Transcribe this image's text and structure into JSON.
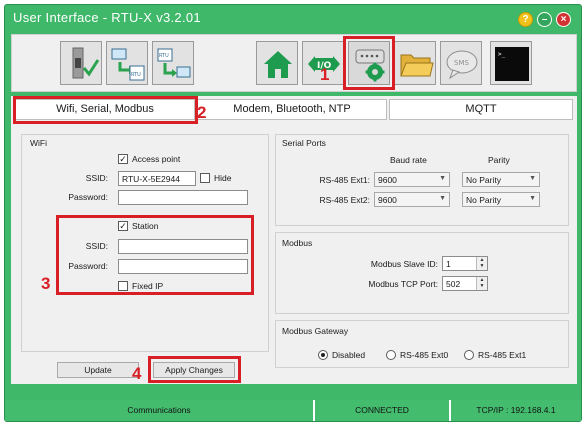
{
  "window": {
    "title": "User Interface - RTU-X v3.2.01",
    "buttons": {
      "help": "?",
      "minimize": "–",
      "close": "×"
    }
  },
  "toolbar": {
    "buttons": [
      {
        "name": "device-check",
        "icon": "usb-plug-check-icon"
      },
      {
        "name": "upload",
        "icon": "pc-to-rtu-upload-icon"
      },
      {
        "name": "download",
        "icon": "rtu-to-pc-download-icon"
      },
      {
        "name": "home",
        "icon": "home-icon"
      },
      {
        "name": "io",
        "icon": "io-arrows-icon",
        "label": "I/O"
      },
      {
        "name": "settings",
        "icon": "serial-port-gear-icon",
        "active": true
      },
      {
        "name": "open-folder",
        "icon": "folder-icon"
      },
      {
        "name": "sms",
        "icon": "sms-bubble-icon",
        "label": "SMS"
      },
      {
        "name": "terminal",
        "icon": "terminal-icon",
        "label": ">_"
      }
    ]
  },
  "annotations": [
    "1",
    "2",
    "3",
    "4"
  ],
  "tabs": [
    {
      "label": "Wifi, Serial, Modbus",
      "active": true
    },
    {
      "label": "Modem, Bluetooth, NTP",
      "active": false
    },
    {
      "label": "MQTT",
      "active": false
    }
  ],
  "wifi": {
    "group_title": "WiFi",
    "access_point": {
      "checkbox_label": "Access point",
      "checked": true,
      "ssid_label": "SSID:",
      "ssid_value": "RTU-X-5E2944",
      "hide_label": "Hide",
      "hide_checked": false,
      "password_label": "Password:",
      "password_value": ""
    },
    "station": {
      "checkbox_label": "Station",
      "checked": true,
      "ssid_label": "SSID:",
      "ssid_value": "",
      "password_label": "Password:",
      "password_value": "",
      "fixed_ip_label": "Fixed IP",
      "fixed_ip_checked": false
    }
  },
  "actions": {
    "update_label": "Update",
    "apply_label": "Apply Changes"
  },
  "serial_ports": {
    "group_title": "Serial Ports",
    "col_baud": "Baud rate",
    "col_parity": "Parity",
    "rows": [
      {
        "label": "RS-485 Ext1:",
        "baud": "9600",
        "parity": "No Parity"
      },
      {
        "label": "RS-485 Ext2:",
        "baud": "9600",
        "parity": "No Parity"
      }
    ]
  },
  "modbus": {
    "group_title": "Modbus",
    "slave_id_label": "Modbus Slave ID:",
    "slave_id_value": "1",
    "tcp_port_label": "Modbus TCP Port:",
    "tcp_port_value": "502"
  },
  "modbus_gateway": {
    "group_title": "Modbus Gateway",
    "options": [
      {
        "label": "Disabled",
        "selected": true
      },
      {
        "label": "RS-485 Ext0",
        "selected": false
      },
      {
        "label": "RS-485 Ext1",
        "selected": false
      }
    ]
  },
  "statusbar": {
    "left": "Communications",
    "middle": "CONNECTED",
    "right": "TCP/IP : 192.168.4.1"
  },
  "colors": {
    "accent_green": "#3fb86a",
    "annotation_red": "#d81f26"
  }
}
